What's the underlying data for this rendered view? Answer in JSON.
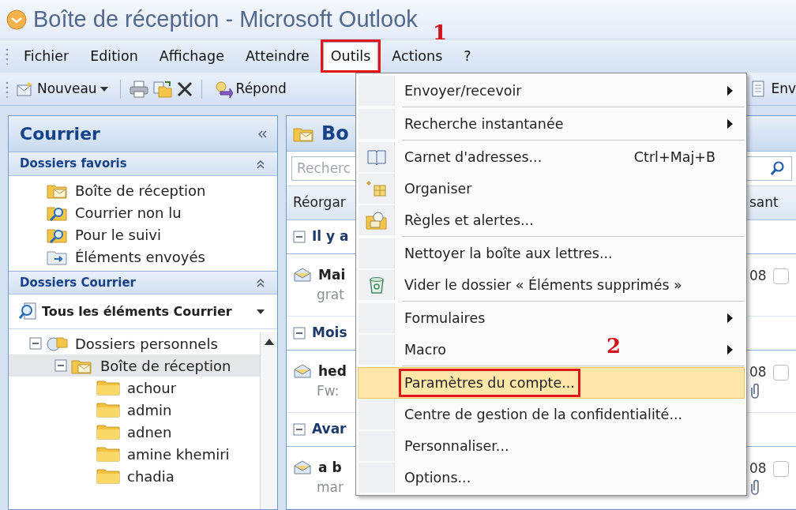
{
  "window": {
    "title": "Boîte de réception - Microsoft Outlook"
  },
  "menu_bar": [
    {
      "label": "Fichier",
      "selected": false
    },
    {
      "label": "Edition",
      "selected": false
    },
    {
      "label": "Affichage",
      "selected": false
    },
    {
      "label": "Atteindre",
      "selected": false
    },
    {
      "label": "Outils",
      "selected": true,
      "annotation": "1"
    },
    {
      "label": "Actions",
      "selected": false
    },
    {
      "label": "?",
      "selected": false
    }
  ],
  "toolbar": [
    {
      "kind": "new",
      "label": "Nouveau"
    },
    {
      "kind": "print"
    },
    {
      "kind": "move"
    },
    {
      "kind": "delete"
    },
    {
      "kind": "reply",
      "label": "Répond"
    },
    {
      "kind": "send",
      "label": "Env"
    }
  ],
  "navigation": {
    "title": "Courrier",
    "favorites": {
      "title": "Dossiers favoris",
      "items": [
        {
          "label": "Boîte de réception",
          "kind": "inbox"
        },
        {
          "label": "Courrier non lu",
          "kind": "search"
        },
        {
          "label": "Pour le suivi",
          "kind": "search"
        },
        {
          "label": "Éléments envoyés",
          "kind": "sent"
        }
      ]
    },
    "mail_folders": {
      "title": "Dossiers Courrier",
      "view": "Tous les éléments Courrier",
      "tree": [
        {
          "label": "Dossiers personnels",
          "kind": "personal",
          "expanded": true,
          "selected": false,
          "children": [
            {
              "label": "Boîte de réception",
              "kind": "inbox",
              "expanded": true,
              "selected": true,
              "children": [
                {
                  "label": "achour",
                  "kind": "folder",
                  "selected": false
                },
                {
                  "label": "admin",
                  "kind": "folder",
                  "selected": false
                },
                {
                  "label": "adnen",
                  "kind": "folder",
                  "selected": false
                },
                {
                  "label": "amine khemiri",
                  "kind": "folder",
                  "selected": false
                },
                {
                  "label": "chadia",
                  "kind": "folder",
                  "selected": false
                }
              ]
            }
          ]
        }
      ]
    }
  },
  "mail_list": {
    "title": "Bo",
    "search_placeholder": "Recherc",
    "arrange_label": "Réorgar",
    "arrange_order": "sant",
    "groups": [
      {
        "label": "Il y a",
        "expanded": true,
        "messages": [
          {
            "sender": "Mai",
            "preview": "grat",
            "date": "08",
            "attachment": false,
            "checked": false
          }
        ]
      },
      {
        "label": "Mois",
        "expanded": true,
        "messages": [
          {
            "sender": "hed",
            "preview": "Fw:",
            "date": "08",
            "attachment": true,
            "checked": false
          }
        ]
      },
      {
        "label": "Avar",
        "expanded": true,
        "messages": [
          {
            "sender": "a b",
            "preview": "mar",
            "date": "08",
            "attachment": true,
            "checked": false
          }
        ]
      }
    ]
  },
  "tools_menu": {
    "items": [
      {
        "label": "Envoyer/recevoir",
        "submenu": true,
        "selected": false,
        "separator_after": true
      },
      {
        "label": "Recherche instantanée",
        "submenu": true,
        "selected": false,
        "separator_after": true
      },
      {
        "label": "Carnet d'adresses...",
        "kind": "address-book",
        "shortcut": "Ctrl+Maj+B",
        "selected": false
      },
      {
        "label": "Organiser",
        "kind": "organize",
        "selected": false
      },
      {
        "label": "Règles et alertes...",
        "kind": "rules",
        "selected": false,
        "separator_after": true
      },
      {
        "label": "Nettoyer la boîte aux lettres...",
        "selected": false
      },
      {
        "label": "Vider le dossier « Éléments supprimés »",
        "kind": "trash",
        "selected": false,
        "separator_after": true
      },
      {
        "label": "Formulaires",
        "submenu": true,
        "selected": false
      },
      {
        "label": "Macro",
        "submenu": true,
        "selected": false,
        "separator_after": true
      },
      {
        "label": "Paramètres du compte...",
        "selected": true,
        "annotation": "2"
      },
      {
        "label": "Centre de gestion de la confidentialité...",
        "selected": false
      },
      {
        "label": "Personnaliser...",
        "selected": false
      },
      {
        "label": "Options...",
        "selected": false
      }
    ]
  }
}
